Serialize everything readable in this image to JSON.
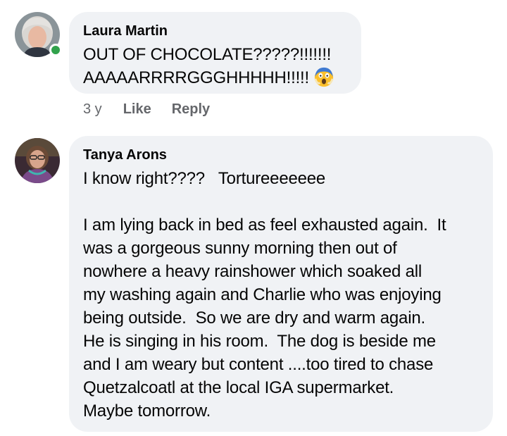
{
  "comments": [
    {
      "author": "Laura Martin",
      "lines": [
        "OUT OF CHOCOLATE?????!!!!!!!",
        "AAAAARRRRGGGHHHHH!!!!!"
      ],
      "emoji": "face-screaming-in-fear",
      "online": true,
      "meta": {
        "time": "3 y",
        "like": "Like",
        "reply": "Reply"
      }
    },
    {
      "author": "Tanya Arons",
      "paragraph1": "I know right????   Tortureeeeeee",
      "paragraph2_lines": [
        "I am lying back in bed as feel exhausted again.  It",
        "was a gorgeous sunny morning then out of",
        "nowhere a heavy rainshower which soaked all",
        "my washing again and Charlie who was enjoying",
        "being outside.  So we are dry and warm again.",
        "He is singing in his room.  The dog is beside me",
        "and I am weary but content ....too tired to chase",
        "Quetzalcoatl at the local IGA supermarket.",
        "Maybe tomorrow."
      ]
    }
  ],
  "colors": {
    "bubble": "#f0f2f5",
    "online": "#31a24c",
    "meta_text": "#65676b"
  }
}
